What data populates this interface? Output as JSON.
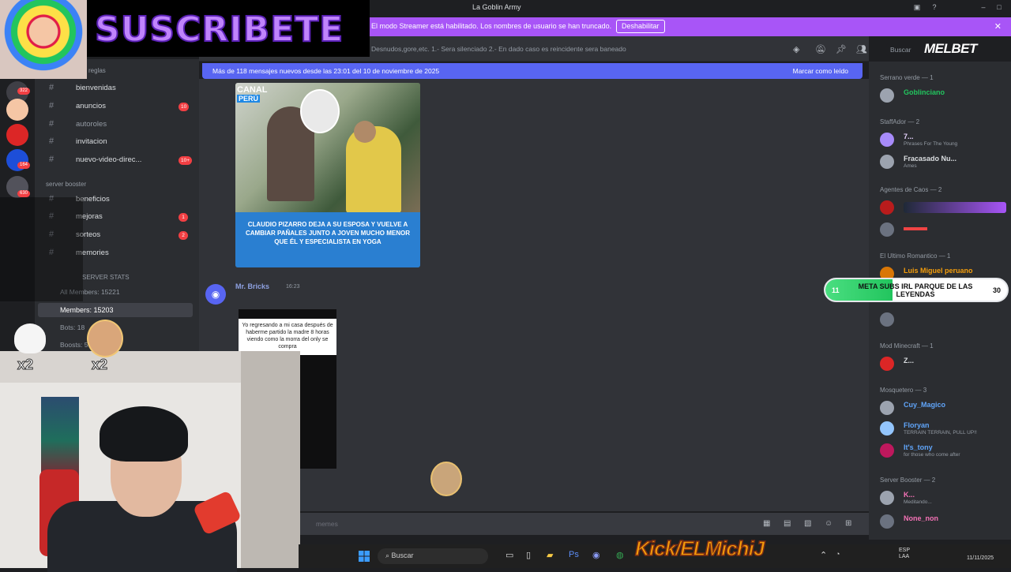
{
  "window": {
    "title": "La Goblin Army"
  },
  "streamer_banner": {
    "message": "El modo Streamer está habilitado. Los nombres de usuario se han truncado.",
    "disable_label": "Deshabilitar",
    "close": "✕"
  },
  "topic_bar": {
    "topic": "Desnudos,gore,etc. 1.- Sera silenciado 2.- En dado caso es reincidente sera baneado",
    "search_placeholder": "Buscar"
  },
  "new_messages": {
    "text": "Más de 118 mensajes nuevos desde las 23:01 del 10 de noviembre de 2025",
    "mark_read": "Marcar como leído"
  },
  "overlay": {
    "subscribe": "SUSCRIBETE",
    "sponsor": "MELBET",
    "kick": "Kick/ELMichiJ",
    "multiplier": "x2"
  },
  "post1": {
    "logo": "CANAL",
    "logo2": "PERÚ",
    "headline": "CLAUDIO PIZARRO DEJA A SU ESPOSA Y VUELVE A CAMBIAR PAÑALES JUNTO A JOVEN MUCHO MENOR QUE ÉL Y ESPECIALISTA EN YOGA"
  },
  "message2": {
    "author": "Mr. Bricks",
    "time": "16:23",
    "caption": "Yo regresando a mi casa después de haberme partido la madre 8 horas viendo como la morra del only se compra"
  },
  "message_input": {
    "placeholder": "memes"
  },
  "left_sidebar": {
    "guild_badges": [
      "322",
      "164",
      "630"
    ],
    "top_label": "reglas",
    "channels": [
      {
        "label": "bienvenidas",
        "badge": ""
      },
      {
        "label": "anuncios",
        "badge": "10"
      },
      {
        "label": "autoroles",
        "badge": ""
      },
      {
        "label": "invitacion",
        "badge": ""
      },
      {
        "label": "nuevo-video-direc...",
        "badge": "10+"
      }
    ],
    "category_booster": "server booster",
    "booster_channels": [
      {
        "label": "beneficios",
        "badge": ""
      },
      {
        "label": "mejoras",
        "badge": "1"
      },
      {
        "label": "sorteos",
        "badge": "2"
      },
      {
        "label": "memories",
        "badge": ""
      }
    ],
    "category_stats": "SERVER STATS",
    "stats": [
      {
        "label": "All Members: 15221"
      },
      {
        "label": "Members: 15203"
      },
      {
        "label": "Bots: 18"
      },
      {
        "label": "Boosts: 5"
      }
    ]
  },
  "members": {
    "groups": [
      {
        "title": "Serrano verde — 1",
        "members": [
          {
            "name": "Goblinciano",
            "status": "",
            "color": "#22c55e"
          }
        ]
      },
      {
        "title": "StaffAdor — 2",
        "members": [
          {
            "name": "7...",
            "status": "Phrases For The Young",
            "color": "#e9d5ff"
          },
          {
            "name": "Fracasado Nu...",
            "status": "Ames",
            "color": "#dbdee1"
          }
        ]
      },
      {
        "title": "Agentes de Caos — 2",
        "members": [
          {
            "name": "",
            "status": "",
            "color": "#ef4444"
          },
          {
            "name": "",
            "status": "",
            "color": "#ef4444"
          }
        ]
      },
      {
        "title": "El Ultimo Romantico — 1",
        "members": [
          {
            "name": "Luis Miguel peruano",
            "status": "",
            "color": "#f59e0b"
          }
        ]
      },
      {
        "title": "Mod Minecraft — 1",
        "members": [
          {
            "name": "Z...",
            "status": "",
            "color": "#dbdee1"
          }
        ]
      },
      {
        "title": "Mosquetero — 3",
        "members": [
          {
            "name": "Cuy_Magico",
            "status": "",
            "color": "#60a5fa"
          },
          {
            "name": "Floryan",
            "status": "TERRAIN TERRAIN, PULL UP!!",
            "color": "#60a5fa"
          },
          {
            "name": "It's_tony",
            "status": "for those who come after",
            "color": "#60a5fa"
          }
        ]
      },
      {
        "title": "Server Booster — 2",
        "members": [
          {
            "name": "K...",
            "status": "Meditando...",
            "color": "#f472b6"
          },
          {
            "name": "None_non",
            "status": "",
            "color": "#f472b6"
          }
        ]
      }
    ]
  },
  "goal": {
    "current": "11",
    "label": "META SUBS IRL PARQUE DE LAS LEYENDAS",
    "target": "30",
    "progress": 0.37
  },
  "taskbar": {
    "search": "Buscar",
    "lang": "ESP LAA",
    "date": "11/11/2025"
  }
}
